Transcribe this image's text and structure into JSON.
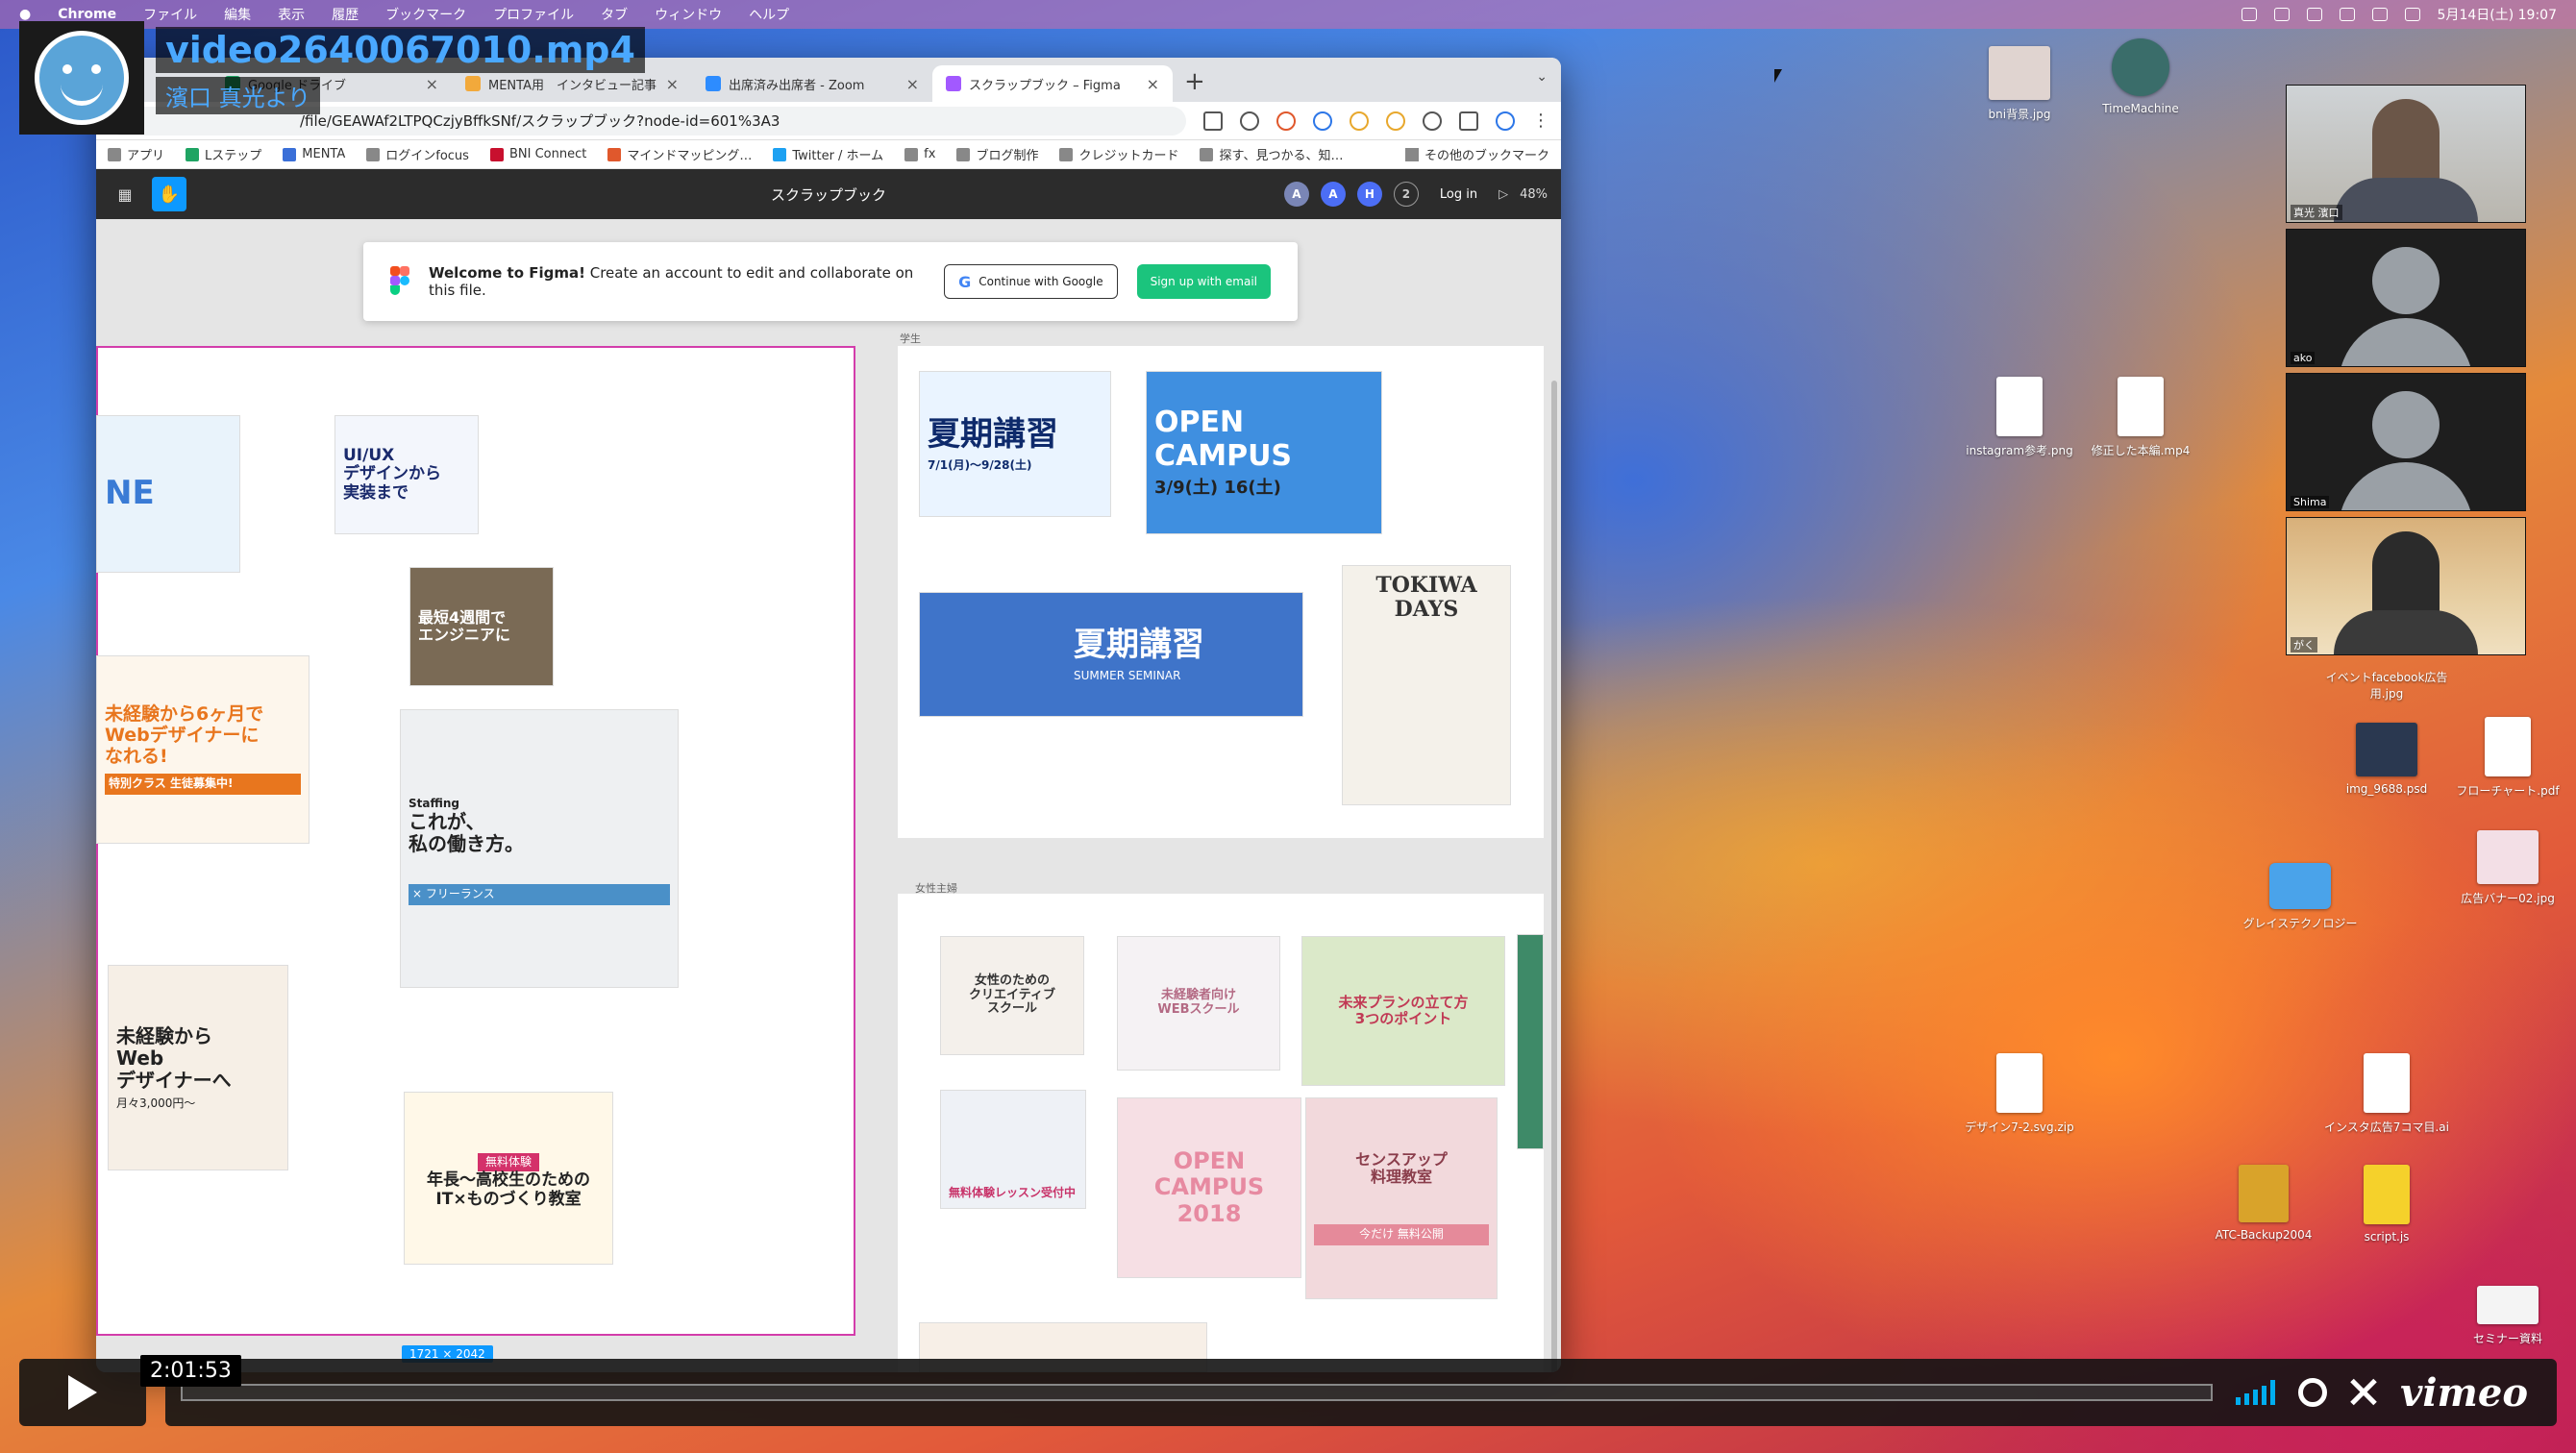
{
  "video": {
    "title": "video2640067010.mp4",
    "from": "濱口 真光より",
    "timestamp": "2:01:53",
    "progress": 0.0
  },
  "menubar": {
    "app": "Chrome",
    "items": [
      "ファイル",
      "編集",
      "表示",
      "履歴",
      "ブックマーク",
      "プロファイル",
      "タブ",
      "ウィンドウ",
      "ヘルプ"
    ],
    "clock": "5月14日(土) 19:07"
  },
  "tabs": [
    {
      "label": "Google ドライブ",
      "color": "#1fa463"
    },
    {
      "label": "MENTA用　インタビュー記事",
      "color": "#f2a93b"
    },
    {
      "label": "出席済み出席者 - Zoom",
      "color": "#2d8cff"
    },
    {
      "label": "スクラップブック – Figma",
      "color": "#a259ff",
      "active": true
    }
  ],
  "url": "/file/GEAWAf2LTPQCzjyBffkSNf/スクラップブック?node-id=601%3A3",
  "bookmarks": [
    "アプリ",
    "Lステップ",
    "MENTA",
    "ログインfocus",
    "BNI Connect",
    "マインドマッピング…",
    "Twitter / ホーム",
    "fx",
    "ブログ制作",
    "クレジットカード",
    "探す、見つかる、知…"
  ],
  "bookmarks_other": "その他のブックマーク",
  "figma": {
    "title": "スクラップブック",
    "avatars": [
      "A",
      "A",
      "H"
    ],
    "avatar_count": "2",
    "login": "Log in",
    "zoom": "48%",
    "welcome_bold": "Welcome to Figma!",
    "welcome_rest": " Create an account to edit and collaborate on this file.",
    "btn_google": "Continue with Google",
    "btn_email": "Sign up with email",
    "frame_size": "1721 × 2042",
    "label_students": "学生",
    "label_women": "女性主婦"
  },
  "banners": {
    "uiux": "UI/UX\nデザインから\n実装まで",
    "engineer": "最短4週間で\nエンジニアに",
    "lig": "未経験から6ヶ月で\nWebデザイナーに\nなれる!",
    "lig_bar": "特別クラス 生徒募集中!",
    "staffing_logo": "Staffing",
    "staffing_main": "これが、\n私の働き方。",
    "staffing_sub": "× フリーランス",
    "webdesigner": "未経験から\nWeb\nデザイナーへ",
    "webdesigner_price": "月々3,000円～",
    "litalico": "年長～高校生のための\nIT×ものづくり教室",
    "litalico_tag": "無料体験",
    "kaki1": "夏期講習",
    "kaki1_sub": "7/1(月)～9/28(土)",
    "opencampus": "OPEN CAMPUS",
    "opencampus_date": "3/9(土) 16(土)",
    "kaki2": "夏期講習",
    "kaki2_sub": "SUMMER SEMINAR",
    "tokiwa": "TOKIWA\nDAYS",
    "women1": "女性のための\nクリエイティブ\nスクール",
    "women2": "未経験者向け\nWEBスクール",
    "women3": "未来プランの立て方\n3つのポイント",
    "women4": "無料体験レッスン受付中",
    "women5": "OPEN\nCAMPUS\n2018",
    "women6": "センスアップ\n料理教室",
    "women7": "今だけ 無料公開"
  },
  "desktop_icons": [
    {
      "label": "bni背景.jpg"
    },
    {
      "label": "TimeMachine"
    },
    {
      "label": "instagram参考.png"
    },
    {
      "label": "修正した本編.mp4"
    },
    {
      "label": "イベントfacebook広告用.jpg"
    },
    {
      "label": "img_9688.psd"
    },
    {
      "label": "フローチャート.pdf"
    },
    {
      "label": "広告バナー02.jpg"
    },
    {
      "label": "グレイステクノロジー"
    },
    {
      "label": "デザイン7-2.svg.zip"
    },
    {
      "label": "インスタ広告7コマ目.ai"
    },
    {
      "label": "ATC-Backup2004"
    },
    {
      "label": "script.js"
    },
    {
      "label": "セミナー資料"
    }
  ],
  "zoom_participants": [
    {
      "name": "真光 濱口"
    },
    {
      "name": "ako"
    },
    {
      "name": "Shima"
    },
    {
      "name": "がく"
    }
  ],
  "vimeo": {
    "logo": "vimeo"
  }
}
